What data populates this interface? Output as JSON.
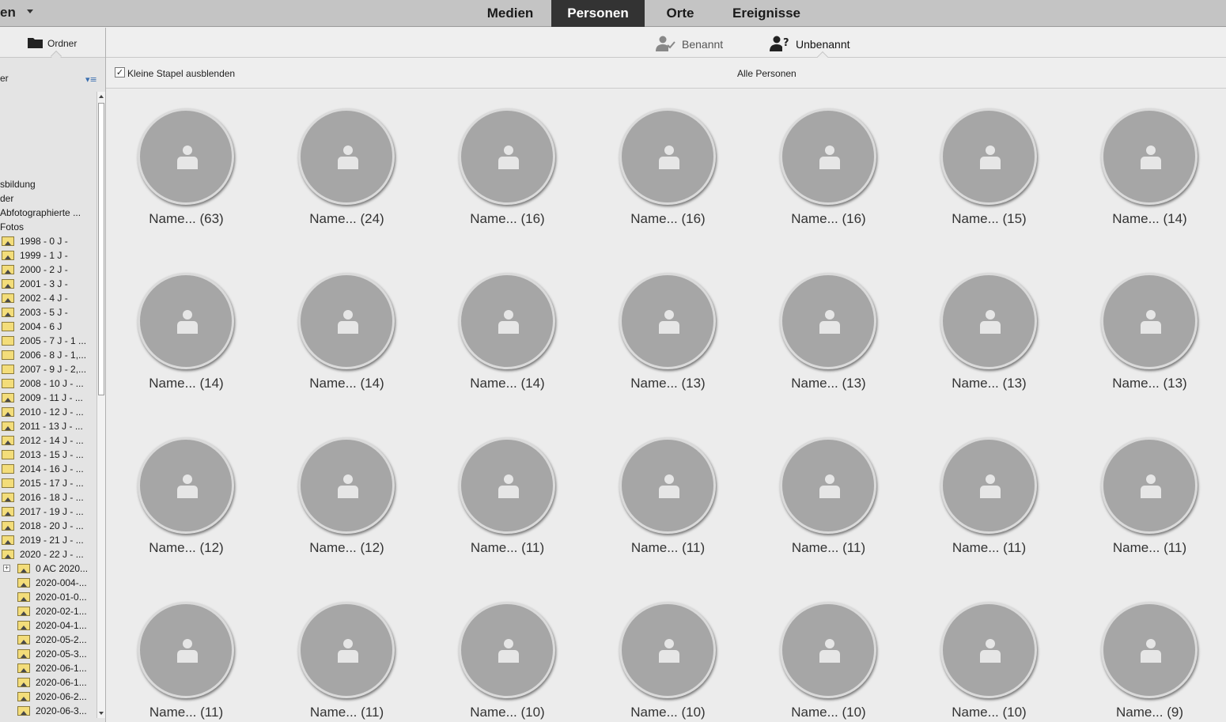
{
  "topbar": {
    "left_label": "en",
    "tabs": [
      {
        "label": "Medien",
        "active": false
      },
      {
        "label": "Personen",
        "active": true
      },
      {
        "label": "Orte",
        "active": false
      },
      {
        "label": "Ereignisse",
        "active": false
      }
    ]
  },
  "left_panel": {
    "header_label": "Ordner",
    "subhead": "er",
    "tree": [
      {
        "label": "sbildung",
        "indent": 0,
        "icon": "none"
      },
      {
        "label": "der",
        "indent": 0,
        "icon": "none"
      },
      {
        "label": "Abfotographierte ...",
        "indent": 1,
        "icon": "none"
      },
      {
        "label": "Fotos",
        "indent": 1,
        "icon": "none"
      },
      {
        "label": "1998 - 0 J -",
        "indent": 2,
        "icon": "photo"
      },
      {
        "label": "1999 - 1 J -",
        "indent": 2,
        "icon": "photo"
      },
      {
        "label": "2000 - 2 J -",
        "indent": 2,
        "icon": "photo"
      },
      {
        "label": "2001 - 3 J -",
        "indent": 2,
        "icon": "photo"
      },
      {
        "label": "2002 - 4 J -",
        "indent": 2,
        "icon": "photo"
      },
      {
        "label": "2003 - 5 J -",
        "indent": 2,
        "icon": "photo"
      },
      {
        "label": "2004 - 6 J",
        "indent": 2,
        "icon": "folder"
      },
      {
        "label": "2005 - 7 J - 1 ...",
        "indent": 2,
        "icon": "folder"
      },
      {
        "label": "2006 - 8 J - 1,...",
        "indent": 2,
        "icon": "folder"
      },
      {
        "label": "2007 - 9 J - 2,...",
        "indent": 2,
        "icon": "folder"
      },
      {
        "label": "2008 - 10 J - ...",
        "indent": 2,
        "icon": "folder"
      },
      {
        "label": "2009 - 11 J - ...",
        "indent": 2,
        "icon": "photo"
      },
      {
        "label": "2010 - 12 J - ...",
        "indent": 2,
        "icon": "photo"
      },
      {
        "label": "2011 - 13 J - ...",
        "indent": 2,
        "icon": "photo"
      },
      {
        "label": "2012 - 14 J - ...",
        "indent": 2,
        "icon": "photo"
      },
      {
        "label": "2013 - 15 J - ...",
        "indent": 2,
        "icon": "folder"
      },
      {
        "label": "2014 - 16 J - ...",
        "indent": 2,
        "icon": "folder"
      },
      {
        "label": "2015 - 17 J - ...",
        "indent": 2,
        "icon": "folder"
      },
      {
        "label": "2016 - 18 J - ...",
        "indent": 2,
        "icon": "photo"
      },
      {
        "label": "2017 - 19 J - ...",
        "indent": 2,
        "icon": "photo"
      },
      {
        "label": "2018 - 20 J - ...",
        "indent": 2,
        "icon": "photo"
      },
      {
        "label": "2019 - 21 J - ...",
        "indent": 2,
        "icon": "photo"
      },
      {
        "label": "2020 - 22 J - ...",
        "indent": 2,
        "icon": "photo"
      },
      {
        "label": "0 AC 2020...",
        "indent": 3,
        "icon": "photo",
        "expander": "+"
      },
      {
        "label": "2020-004-...",
        "indent": 3,
        "icon": "photo"
      },
      {
        "label": "2020-01-0...",
        "indent": 3,
        "icon": "photo"
      },
      {
        "label": "2020-02-1...",
        "indent": 3,
        "icon": "photo"
      },
      {
        "label": "2020-04-1...",
        "indent": 3,
        "icon": "photo"
      },
      {
        "label": "2020-05-2...",
        "indent": 3,
        "icon": "photo"
      },
      {
        "label": "2020-05-3...",
        "indent": 3,
        "icon": "photo"
      },
      {
        "label": "2020-06-1...",
        "indent": 3,
        "icon": "photo"
      },
      {
        "label": "2020-06-1...",
        "indent": 3,
        "icon": "photo"
      },
      {
        "label": "2020-06-2...",
        "indent": 3,
        "icon": "photo"
      },
      {
        "label": "2020-06-3...",
        "indent": 3,
        "icon": "photo"
      }
    ]
  },
  "subtabs": {
    "named": "Benannt",
    "unnamed": "Unbenannt"
  },
  "filterbar": {
    "checkbox_checked": true,
    "checkbox_label": "Kleine Stapel ausblenden",
    "all_label": "Alle Personen"
  },
  "people": [
    "Name... (63)",
    "Name... (24)",
    "Name... (16)",
    "Name... (16)",
    "Name... (16)",
    "Name... (15)",
    "Name... (14)",
    "Name... (14)",
    "Name... (14)",
    "Name... (14)",
    "Name... (13)",
    "Name... (13)",
    "Name... (13)",
    "Name... (13)",
    "Name... (12)",
    "Name... (12)",
    "Name... (11)",
    "Name... (11)",
    "Name... (11)",
    "Name... (11)",
    "Name... (11)",
    "Name... (11)",
    "Name... (11)",
    "Name... (10)",
    "Name... (10)",
    "Name... (10)",
    "Name... (10)",
    "Name... (9)"
  ],
  "colors": {
    "active_tab": "#333333",
    "avatar": "#a6a6a6",
    "accent": "#3a6fb0"
  }
}
